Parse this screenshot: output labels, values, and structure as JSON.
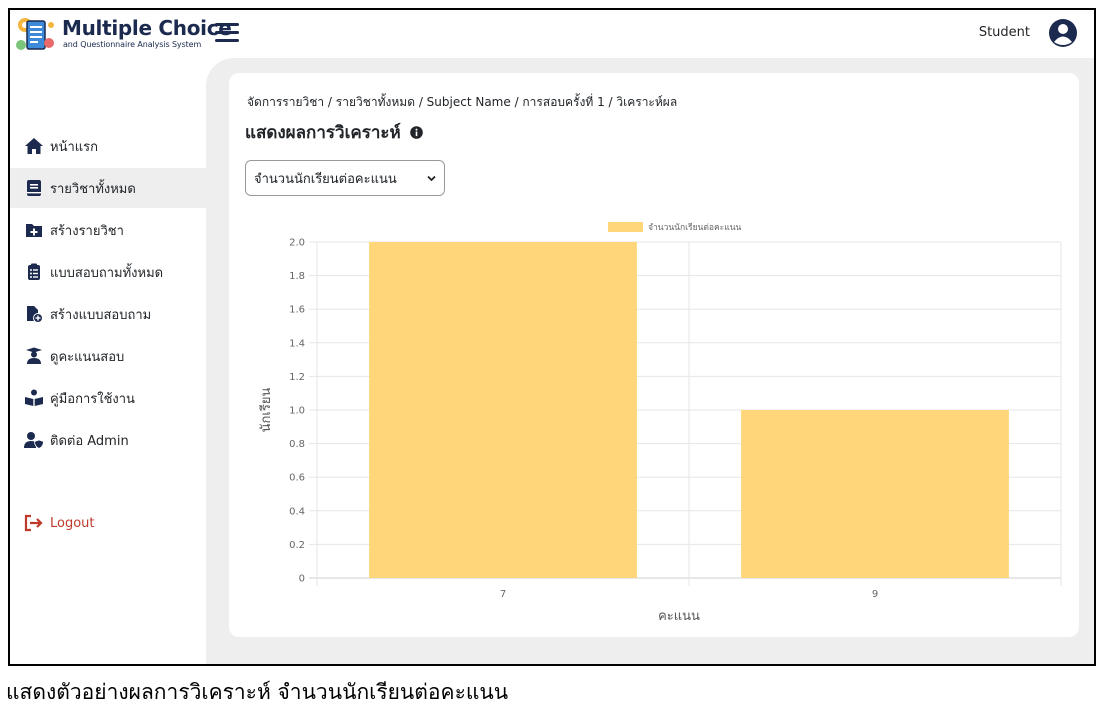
{
  "app": {
    "title": "Multiple Choice",
    "subtitle": "and Questionnaire Analysis System"
  },
  "header": {
    "user": "Student"
  },
  "sidebar": {
    "items": [
      {
        "label": "หน้าแรก",
        "icon": "home-icon"
      },
      {
        "label": "รายวิชาทั้งหมด",
        "icon": "book-icon",
        "active": true
      },
      {
        "label": "สร้างรายวิชา",
        "icon": "folder-plus-icon"
      },
      {
        "label": "แบบสอบถามทั้งหมด",
        "icon": "clipboard-list-icon"
      },
      {
        "label": "สร้างแบบสอบถาม",
        "icon": "file-plus-icon"
      },
      {
        "label": "ดูคะแนนสอบ",
        "icon": "graduate-icon"
      },
      {
        "label": "คู่มือการใช้งาน",
        "icon": "reading-icon"
      },
      {
        "label": "ติดต่อ Admin",
        "icon": "user-shield-icon"
      }
    ],
    "logout": "Logout"
  },
  "main": {
    "breadcrumb": "จัดการรายวิชา / รายวิชาทั้งหมด / Subject Name / การสอบครั้งที่ 1 / วิเคราะห์ผล",
    "title": "แสดงผลการวิเคราะห์",
    "select": {
      "selected": "จำนวนนักเรียนต่อคะแนน"
    }
  },
  "chart_data": {
    "type": "bar",
    "categories": [
      "7",
      "9"
    ],
    "series": [
      {
        "name": "จำนวนนักเรียนต่อคะแนน",
        "values": [
          2,
          1
        ],
        "color": "#ffd77a"
      }
    ],
    "ylim": [
      0,
      2.0
    ],
    "yticks": [
      "0",
      "0.2",
      "0.4",
      "0.6",
      "0.8",
      "1.0",
      "1.2",
      "1.4",
      "1.6",
      "1.8",
      "2.0"
    ],
    "xlabel": "คะแนน",
    "ylabel": "นักเรียน",
    "legend": "top-center",
    "grid": true
  },
  "caption": "แสดงตัวอย่างผลการวิเคราะห์ จำนวนนักเรียนต่อคะแนน",
  "colors": {
    "brand": "#1b2a4e",
    "bar": "#ffd77a",
    "logout": "#c0392b",
    "background": "#eeeeee"
  }
}
